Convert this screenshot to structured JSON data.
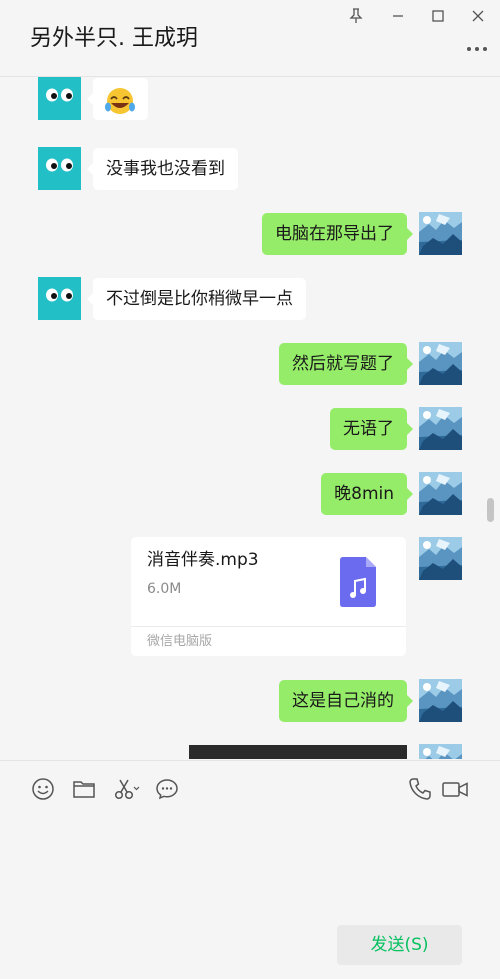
{
  "window": {
    "title": "另外半只. 王成玥",
    "pin_icon": "pin-icon",
    "minimize_icon": "minimize-icon",
    "maximize_icon": "maximize-icon",
    "close_icon": "close-icon",
    "more_icon": "more-icon"
  },
  "messages": [
    {
      "side": "left",
      "type": "emoji",
      "text": ""
    },
    {
      "side": "left",
      "type": "text",
      "text": "没事我也没看到"
    },
    {
      "side": "right",
      "type": "text",
      "text": "电脑在那导出了"
    },
    {
      "side": "left",
      "type": "text",
      "text": "不过倒是比你稍微早一点"
    },
    {
      "side": "right",
      "type": "text",
      "text": "然后就写题了"
    },
    {
      "side": "right",
      "type": "text",
      "text": "无语了"
    },
    {
      "side": "right",
      "type": "text",
      "text": "晚8min"
    },
    {
      "side": "right",
      "type": "file",
      "file_name": "消音伴奏.mp3",
      "file_size": "6.0M",
      "file_source": "微信电脑版",
      "file_icon": "music-file-icon"
    },
    {
      "side": "right",
      "type": "text",
      "text": "这是自己消的"
    },
    {
      "side": "right",
      "type": "image",
      "text": ""
    }
  ],
  "toolbar": {
    "icons": [
      "emoji-icon",
      "folder-icon",
      "scissors-icon",
      "chat-history-icon",
      "phone-icon",
      "video-call-icon"
    ],
    "send_label": "发送(S)"
  },
  "colors": {
    "sent_bubble": "#95ec69",
    "received_bubble": "#ffffff",
    "send_text": "#07c160",
    "file_icon": "#6b6bef",
    "contact_avatar": "#22bfc6"
  }
}
